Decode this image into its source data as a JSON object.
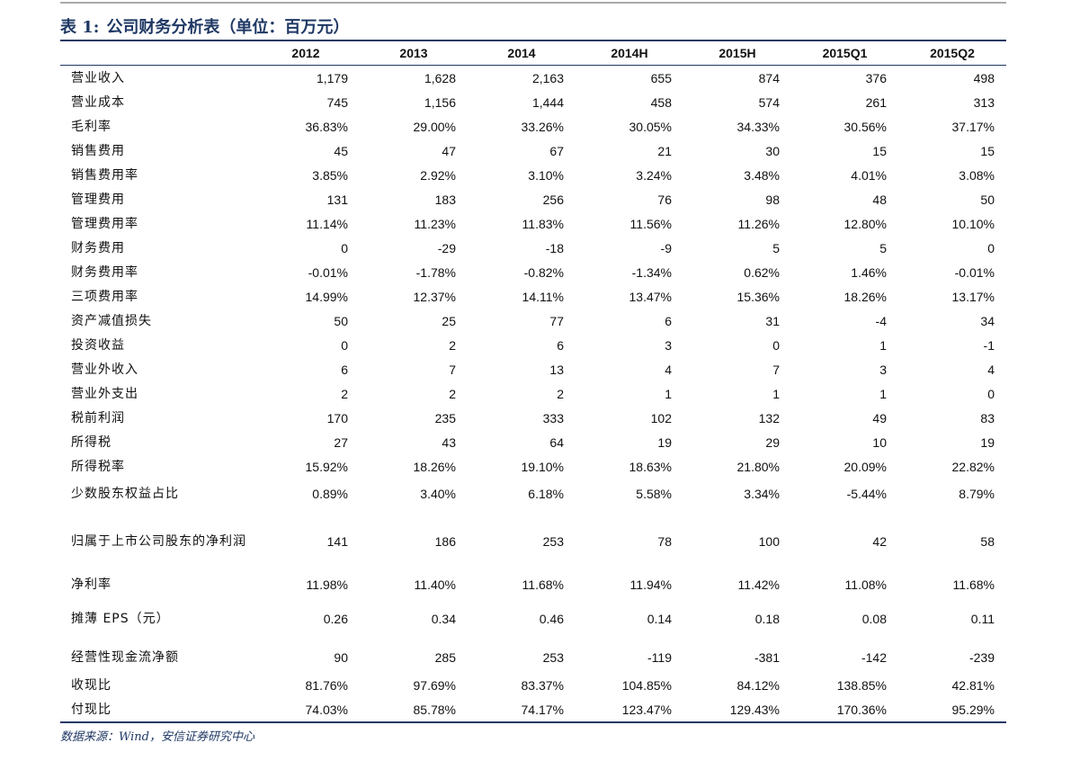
{
  "caption": {
    "label": "表 1:",
    "text": "公司财务分析表（单位：百万元）"
  },
  "table": {
    "headers": [
      "",
      "2012",
      "2013",
      "2014",
      "2014H",
      "2015H",
      "2015Q1",
      "2015Q2"
    ],
    "rows": [
      {
        "label": "营业收入",
        "values": [
          "1,179",
          "1,628",
          "2,163",
          "655",
          "874",
          "376",
          "498"
        ]
      },
      {
        "label": "营业成本",
        "values": [
          "745",
          "1,156",
          "1,444",
          "458",
          "574",
          "261",
          "313"
        ]
      },
      {
        "label": "毛利率",
        "values": [
          "36.83%",
          "29.00%",
          "33.26%",
          "30.05%",
          "34.33%",
          "30.56%",
          "37.17%"
        ]
      },
      {
        "label": "销售费用",
        "values": [
          "45",
          "47",
          "67",
          "21",
          "30",
          "15",
          "15"
        ]
      },
      {
        "label": "销售费用率",
        "values": [
          "3.85%",
          "2.92%",
          "3.10%",
          "3.24%",
          "3.48%",
          "4.01%",
          "3.08%"
        ]
      },
      {
        "label": "管理费用",
        "values": [
          "131",
          "183",
          "256",
          "76",
          "98",
          "48",
          "50"
        ]
      },
      {
        "label": "管理费用率",
        "values": [
          "11.14%",
          "11.23%",
          "11.83%",
          "11.56%",
          "11.26%",
          "12.80%",
          "10.10%"
        ]
      },
      {
        "label": "财务费用",
        "values": [
          "0",
          "-29",
          "-18",
          "-9",
          "5",
          "5",
          "0"
        ]
      },
      {
        "label": "财务费用率",
        "values": [
          "-0.01%",
          "-1.78%",
          "-0.82%",
          "-1.34%",
          "0.62%",
          "1.46%",
          "-0.01%"
        ]
      },
      {
        "label": "三项费用率",
        "values": [
          "14.99%",
          "12.37%",
          "14.11%",
          "13.47%",
          "15.36%",
          "18.26%",
          "13.17%"
        ]
      },
      {
        "label": "资产减值损失",
        "values": [
          "50",
          "25",
          "77",
          "6",
          "31",
          "-4",
          "34"
        ]
      },
      {
        "label": "投资收益",
        "values": [
          "0",
          "2",
          "6",
          "3",
          "0",
          "1",
          "-1"
        ]
      },
      {
        "label": "营业外收入",
        "values": [
          "6",
          "7",
          "13",
          "4",
          "7",
          "3",
          "4"
        ]
      },
      {
        "label": "营业外支出",
        "values": [
          "2",
          "2",
          "2",
          "1",
          "1",
          "1",
          "0"
        ]
      },
      {
        "label": "税前利润",
        "values": [
          "170",
          "235",
          "333",
          "102",
          "132",
          "49",
          "83"
        ]
      },
      {
        "label": "所得税",
        "values": [
          "27",
          "43",
          "64",
          "19",
          "29",
          "10",
          "19"
        ]
      },
      {
        "label": "所得税率",
        "values": [
          "15.92%",
          "18.26%",
          "19.10%",
          "18.63%",
          "21.80%",
          "20.09%",
          "22.82%"
        ]
      },
      {
        "label": "少数股东权益占比",
        "values": [
          "0.89%",
          "3.40%",
          "6.18%",
          "5.58%",
          "3.34%",
          "-5.44%",
          "8.79%"
        ]
      },
      {
        "label": "归属于上市公司股东的净利润",
        "values": [
          "141",
          "186",
          "253",
          "78",
          "100",
          "42",
          "58"
        ]
      },
      {
        "label": "净利率",
        "values": [
          "11.98%",
          "11.40%",
          "11.68%",
          "11.94%",
          "11.42%",
          "11.08%",
          "11.68%"
        ]
      },
      {
        "label": "摊薄 EPS（元）",
        "values": [
          "0.26",
          "0.34",
          "0.46",
          "0.14",
          "0.18",
          "0.08",
          "0.11"
        ]
      },
      {
        "label": "经营性现金流净额",
        "values": [
          "90",
          "285",
          "253",
          "-119",
          "-381",
          "-142",
          "-239"
        ]
      },
      {
        "label": "收现比",
        "values": [
          "81.76%",
          "97.69%",
          "83.37%",
          "104.85%",
          "84.12%",
          "138.85%",
          "42.81%"
        ]
      },
      {
        "label": "付现比",
        "values": [
          "74.03%",
          "85.78%",
          "74.17%",
          "123.47%",
          "129.43%",
          "170.36%",
          "95.29%"
        ]
      }
    ]
  },
  "source": "数据来源：Wind，安信证券研究中心"
}
